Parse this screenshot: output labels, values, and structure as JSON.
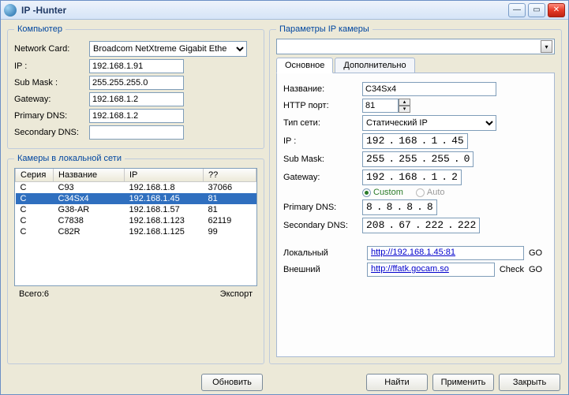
{
  "window": {
    "title": "IP -Hunter"
  },
  "computer": {
    "legend": "Компьютер",
    "nic_label": "Network Card:",
    "nic_value": "Broadcom NetXtreme Gigabit Ethe",
    "ip_label": "IP :",
    "ip_value": "192.168.1.91",
    "mask_label": "Sub Mask :",
    "mask_value": "255.255.255.0",
    "gw_label": "Gateway:",
    "gw_value": "192.168.1.2",
    "dns1_label": "Primary DNS:",
    "dns1_value": "192.168.1.2",
    "dns2_label": "Secondary DNS:",
    "dns2_value": ""
  },
  "cameras": {
    "legend": "Камеры в локальной сети",
    "cols": {
      "series": "Серия",
      "name": "Название",
      "ip": "IP",
      "q": "??"
    },
    "rows": [
      {
        "s": "C",
        "n": "C93",
        "ip": "192.168.1.8",
        "q": "37066"
      },
      {
        "s": "C",
        "n": "C34Sx4",
        "ip": "192.168.1.45",
        "q": "81",
        "sel": true
      },
      {
        "s": "C",
        "n": "G38-AR",
        "ip": "192.168.1.57",
        "q": "81"
      },
      {
        "s": "C",
        "n": "C7838",
        "ip": "192.168.1.123",
        "q": "62119"
      },
      {
        "s": "C",
        "n": "C82R",
        "ip": "192.168.1.125",
        "q": "99"
      }
    ],
    "total_label": "Всего:6",
    "export_label": "Экспорт"
  },
  "buttons": {
    "refresh": "Обновить",
    "find": "Найти",
    "apply": "Применить",
    "close": "Закрыть"
  },
  "params": {
    "legend": "Параметры IP камеры",
    "tab_main": "Основное",
    "tab_extra": "Дополнительно",
    "name_label": "Название:",
    "name_value": "C34Sx4",
    "http_label": "HTTP порт:",
    "http_value": "81",
    "nettype_label": "Тип сети:",
    "nettype_value": "Статический IP",
    "ip_label": "IP :",
    "ip": [
      "192",
      "168",
      "1",
      "45"
    ],
    "mask_label": "Sub Mask:",
    "mask": [
      "255",
      "255",
      "255",
      "0"
    ],
    "gw_label": "Gateway:",
    "gw": [
      "192",
      "168",
      "1",
      "2"
    ],
    "radio_custom": "Custom",
    "radio_auto": "Auto",
    "dns1_label": "Primary DNS:",
    "dns1": [
      "8",
      "8",
      "8",
      "8"
    ],
    "dns2_label": "Secondary DNS:",
    "dns2": [
      "208",
      "67",
      "222",
      "222"
    ],
    "local_label": "Локальный",
    "local_url": "http://192.168.1.45:81",
    "ext_label": "Внешний",
    "ext_url": "http://ffatk.gocam.so",
    "go": "GO",
    "check": "Check"
  }
}
